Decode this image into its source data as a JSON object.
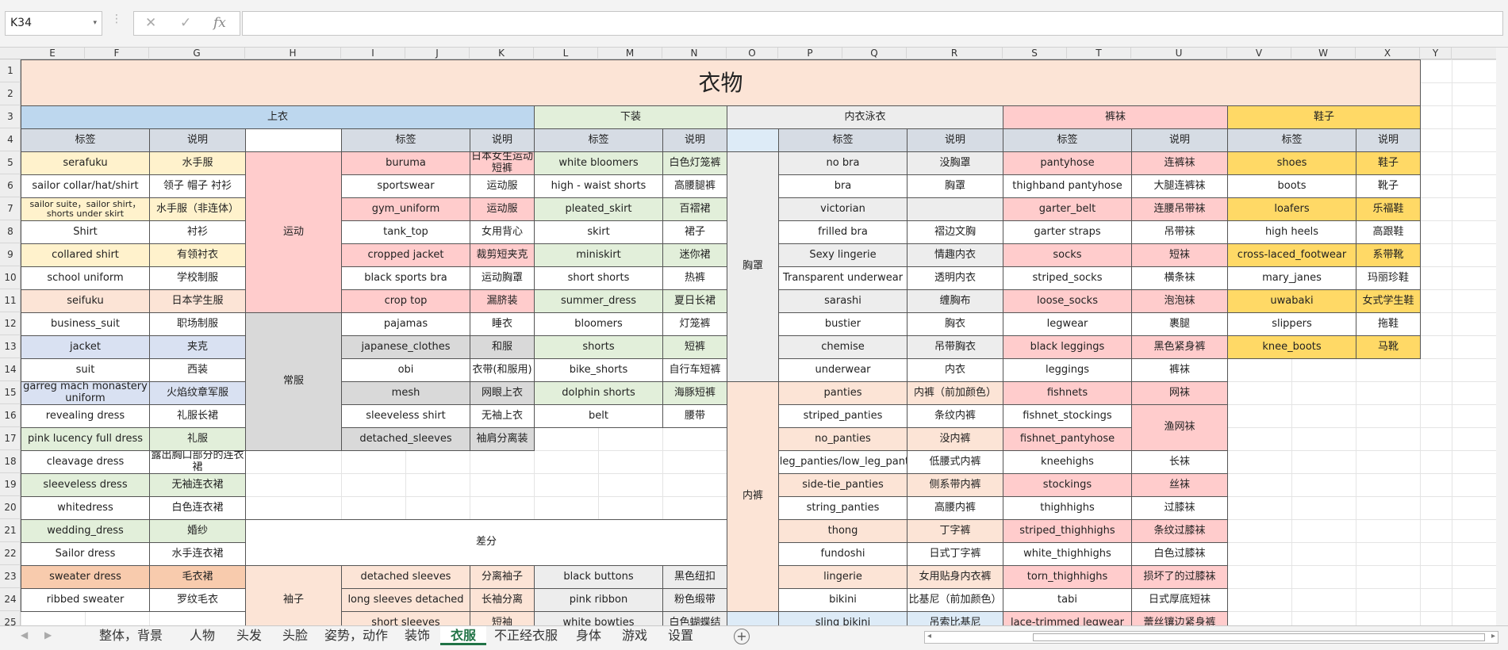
{
  "formula_bar": {
    "name_box": "K34",
    "name_dropdown": "▾",
    "menu_dots": "⋮",
    "cancel": "✕",
    "enter": "✓",
    "fx": "fx",
    "formula": ""
  },
  "columns": [
    "E",
    "F",
    "G",
    "H",
    "I",
    "J",
    "K",
    "L",
    "M",
    "N",
    "O",
    "P",
    "Q",
    "R",
    "S",
    "T",
    "U",
    "V",
    "W",
    "X",
    "Y"
  ],
  "rows": [
    "1",
    "2",
    "3",
    "4",
    "5",
    "6",
    "7",
    "8",
    "9",
    "10",
    "11",
    "12",
    "13",
    "14",
    "15",
    "16",
    "17",
    "18",
    "19",
    "20",
    "21",
    "22",
    "23",
    "24",
    "25"
  ],
  "sheet": {
    "title": "衣物",
    "sections": {
      "tops": "上衣",
      "bottoms": "下装",
      "underwear": "内衣泳衣",
      "hosiery": "裤袜",
      "shoes": "鞋子",
      "diff": "差分"
    },
    "group_labels": {
      "sport": "运动",
      "casual": "常服",
      "bra": "胸罩",
      "panties": "内裤",
      "sleeves": "袖子"
    },
    "headers": {
      "tag": "标签",
      "desc": "说明"
    },
    "col_eg": [
      [
        "serafuku",
        "水手服"
      ],
      [
        "sailor collar/hat/shirt",
        "领子 帽子 衬衫"
      ],
      [
        "sailor suite，sailor shirt，shorts under skirt",
        "水手服（非连体）"
      ],
      [
        "Shirt",
        "衬衫"
      ],
      [
        "collared shirt",
        "有领衬衣"
      ],
      [
        "school uniform",
        "学校制服"
      ],
      [
        "seifuku",
        "日本学生服"
      ],
      [
        "business_suit",
        "职场制服"
      ],
      [
        "jacket",
        "夹克"
      ],
      [
        "suit",
        "西装"
      ],
      [
        "garreg mach monastery uniform",
        "火焰纹章军服"
      ],
      [
        "revealing dress",
        "礼服长裙"
      ],
      [
        "pink lucency full dress",
        "礼服"
      ],
      [
        "cleavage dress",
        "露出胸口部分的连衣裙"
      ],
      [
        "sleeveless dress",
        "无袖连衣裙"
      ],
      [
        "whitedress",
        "白色连衣裙"
      ],
      [
        "wedding_dress",
        "婚纱"
      ],
      [
        "Sailor dress",
        "水手连衣裙"
      ],
      [
        "sweater dress",
        "毛衣裙"
      ],
      [
        "ribbed sweater",
        "罗纹毛衣"
      ]
    ],
    "col_ik": [
      [
        "buruma",
        "日本女生运动短裤"
      ],
      [
        "sportswear",
        "运动服"
      ],
      [
        "gym_uniform",
        "运动服"
      ],
      [
        "tank_top",
        "女用背心"
      ],
      [
        "cropped jacket",
        "裁剪短夹克"
      ],
      [
        "black sports bra",
        "运动胸罩"
      ],
      [
        "crop top",
        "漏脐装"
      ],
      [
        "pajamas",
        "睡衣"
      ],
      [
        "japanese_clothes",
        "和服"
      ],
      [
        "obi",
        "衣带(和服用)"
      ],
      [
        "mesh",
        "网眼上衣"
      ],
      [
        "sleeveless shirt",
        "无袖上衣"
      ],
      [
        "detached_sleeves",
        "袖肩分离装"
      ]
    ],
    "col_ln": [
      [
        "white bloomers",
        "白色灯笼裤"
      ],
      [
        "high - waist shorts",
        "高腰腿裤"
      ],
      [
        "pleated_skirt",
        "百褶裙"
      ],
      [
        "skirt",
        "裙子"
      ],
      [
        "miniskirt",
        "迷你裙"
      ],
      [
        "short shorts",
        "热裤"
      ],
      [
        "summer_dress",
        "夏日长裙"
      ],
      [
        "bloomers",
        "灯笼裤"
      ],
      [
        "shorts",
        "短裤"
      ],
      [
        "bike_shorts",
        "自行车短裤"
      ],
      [
        "dolphin shorts",
        "海豚短裤"
      ],
      [
        "belt",
        "腰带"
      ]
    ],
    "col_pr": [
      [
        "no bra",
        "没胸罩"
      ],
      [
        "bra",
        "胸罩"
      ],
      [
        "victorian",
        ""
      ],
      [
        "frilled bra",
        "褶边文胸"
      ],
      [
        "Sexy lingerie",
        "情趣内衣"
      ],
      [
        "Transparent underwear",
        "透明内衣"
      ],
      [
        "sarashi",
        "缠胸布"
      ],
      [
        "bustier",
        "胸衣"
      ],
      [
        "chemise",
        "吊带胸衣"
      ],
      [
        "underwear",
        "内衣"
      ],
      [
        "panties",
        "内裤（前加颜色）"
      ],
      [
        "striped_panties",
        "条纹内裤"
      ],
      [
        "no_panties",
        "没内裤"
      ],
      [
        "lowleg_panties/low_leg_panties",
        "低腰式内裤"
      ],
      [
        "side-tie_panties",
        "侧系带内裤"
      ],
      [
        "string_panties",
        "高腰内裤"
      ],
      [
        "thong",
        "丁字裤"
      ],
      [
        "fundoshi",
        "日式丁字裤"
      ],
      [
        "lingerie",
        "女用贴身内衣裤"
      ],
      [
        "bikini",
        "比基尼（前加颜色）"
      ],
      [
        "sling bikini",
        "吊索比基尼"
      ]
    ],
    "col_su": [
      [
        "pantyhose",
        "连裤袜"
      ],
      [
        "thighband pantyhose",
        "大腿连裤袜"
      ],
      [
        "garter_belt",
        "连腰吊带袜"
      ],
      [
        "garter straps",
        "吊带袜"
      ],
      [
        "socks",
        "短袜"
      ],
      [
        "striped_socks",
        "横条袜"
      ],
      [
        "loose_socks",
        "泡泡袜"
      ],
      [
        "legwear",
        "裹腿"
      ],
      [
        "black leggings",
        "黑色紧身裤"
      ],
      [
        "leggings",
        "裤袜"
      ],
      [
        "fishnets",
        "网袜"
      ],
      [
        "fishnet_stockings",
        "渔网袜"
      ],
      [
        "fishnet_pantyhose",
        ""
      ],
      [
        "kneehighs",
        "长袜"
      ],
      [
        "stockings",
        "丝袜"
      ],
      [
        "thighhighs",
        "过膝袜"
      ],
      [
        "striped_thighhighs",
        "条纹过膝袜"
      ],
      [
        "white_thighhighs",
        "白色过膝袜"
      ],
      [
        "torn_thighhighs",
        "损坏了的过膝袜"
      ],
      [
        "tabi",
        "日式厚底短袜"
      ],
      [
        "lace-trimmed legwear",
        "蕾丝镶边紧身裤"
      ]
    ],
    "col_vx": [
      [
        "shoes",
        "鞋子"
      ],
      [
        "boots",
        "靴子"
      ],
      [
        "loafers",
        "乐福鞋"
      ],
      [
        "high heels",
        "高跟鞋"
      ],
      [
        "cross-laced_footwear",
        "系带靴"
      ],
      [
        "mary_janes",
        "玛丽珍鞋"
      ],
      [
        "uwabaki",
        "女式学生鞋"
      ],
      [
        "slippers",
        "拖鞋"
      ],
      [
        "knee_boots",
        "马靴"
      ]
    ],
    "diff_ik": [
      [
        "detached sleeves",
        "分离袖子"
      ],
      [
        "long sleeves detached",
        "长袖分离"
      ],
      [
        "short sleeves",
        "短袖"
      ]
    ],
    "diff_ln": [
      [
        "black buttons",
        "黑色纽扣"
      ],
      [
        "pink ribbon",
        "粉色缎带"
      ],
      [
        "white bowties",
        "白色蝴蝶结"
      ]
    ]
  },
  "tabs": [
    "整体，背景",
    "人物",
    "头发",
    "头脸",
    "姿势，动作",
    "装饰",
    "衣服",
    "不正经衣服",
    "身体",
    "游戏",
    "设置"
  ],
  "active_tab": "衣服",
  "sheet_nav": {
    "prev": "◀",
    "next": "▶",
    "add": "+",
    "scroll_left": "◂",
    "scroll_right": "▸"
  },
  "colors": {
    "title_bg": "#fce4d6",
    "tops_hdr": "#bdd7ee",
    "bottoms_hdr": "#e2efda",
    "underwear_hdr": "#ededed",
    "hosiery_hdr": "#ffcccc",
    "shoes_hdr": "#ffd966",
    "tab_active": "#217346"
  }
}
